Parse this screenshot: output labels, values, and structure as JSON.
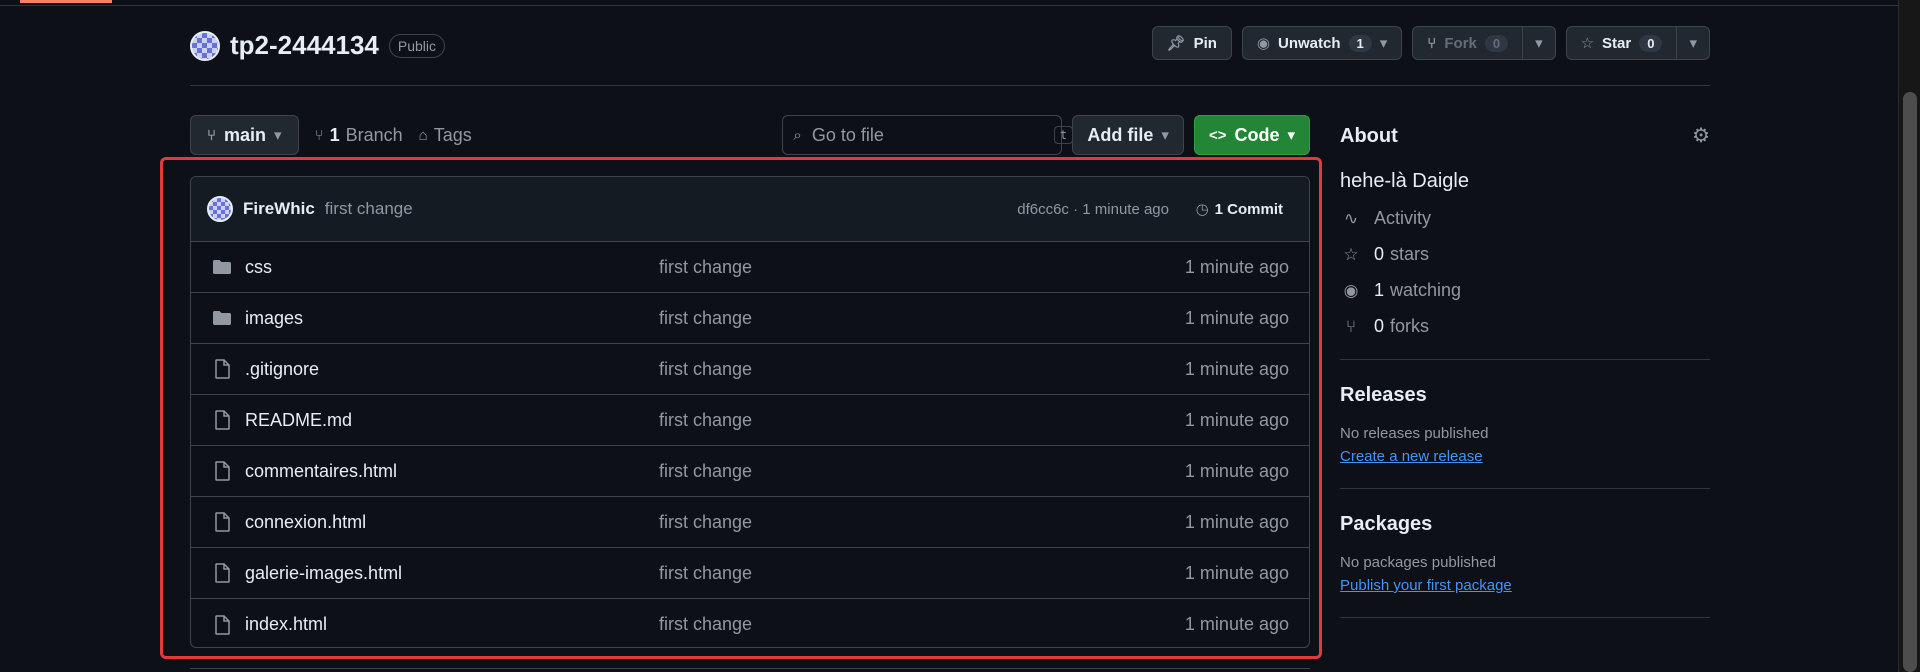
{
  "repo": {
    "name": "tp2-2444134",
    "visibility": "Public",
    "pin_label": "Pin",
    "watch_label": "Unwatch",
    "watch_count": "1",
    "fork_label": "Fork",
    "fork_count": "0",
    "star_label": "Star",
    "star_count": "0"
  },
  "toolbar": {
    "branch": "main",
    "branches_count": "1",
    "branches_label": "Branch",
    "tags_label": "Tags",
    "search_placeholder": "Go to file",
    "search_key": "t",
    "add_file_label": "Add file",
    "code_label": "Code"
  },
  "commit": {
    "user": "FireWhic",
    "message": "first change",
    "meta": "df6cc6c · 1 minute ago",
    "count_label": "1 Commit"
  },
  "files": [
    {
      "name": "css",
      "type": "folder",
      "message": "first change",
      "time": "1 minute ago"
    },
    {
      "name": "images",
      "type": "folder",
      "message": "first change",
      "time": "1 minute ago"
    },
    {
      "name": ".gitignore",
      "type": "file",
      "message": "first change",
      "time": "1 minute ago"
    },
    {
      "name": "README.md",
      "type": "file",
      "message": "first change",
      "time": "1 minute ago"
    },
    {
      "name": "commentaires.html",
      "type": "file",
      "message": "first change",
      "time": "1 minute ago"
    },
    {
      "name": "connexion.html",
      "type": "file",
      "message": "first change",
      "time": "1 minute ago"
    },
    {
      "name": "galerie-images.html",
      "type": "file",
      "message": "first change",
      "time": "1 minute ago"
    },
    {
      "name": "index.html",
      "type": "file",
      "message": "first change",
      "time": "1 minute ago"
    }
  ],
  "about": {
    "heading": "About",
    "description": "hehe-là Daigle",
    "activity": "Activity",
    "stars_count": "0",
    "stars_label": "stars",
    "watching_count": "1",
    "watching_label": "watching",
    "forks_count": "0",
    "forks_label": "forks"
  },
  "releases": {
    "heading": "Releases",
    "empty": "No releases published",
    "link": "Create a new release"
  },
  "packages": {
    "heading": "Packages",
    "empty": "No packages published",
    "link": "Publish your first package"
  },
  "colors": {
    "accent_green": "#238636",
    "highlight_red": "#e5383b",
    "link_blue": "#4493f8"
  }
}
